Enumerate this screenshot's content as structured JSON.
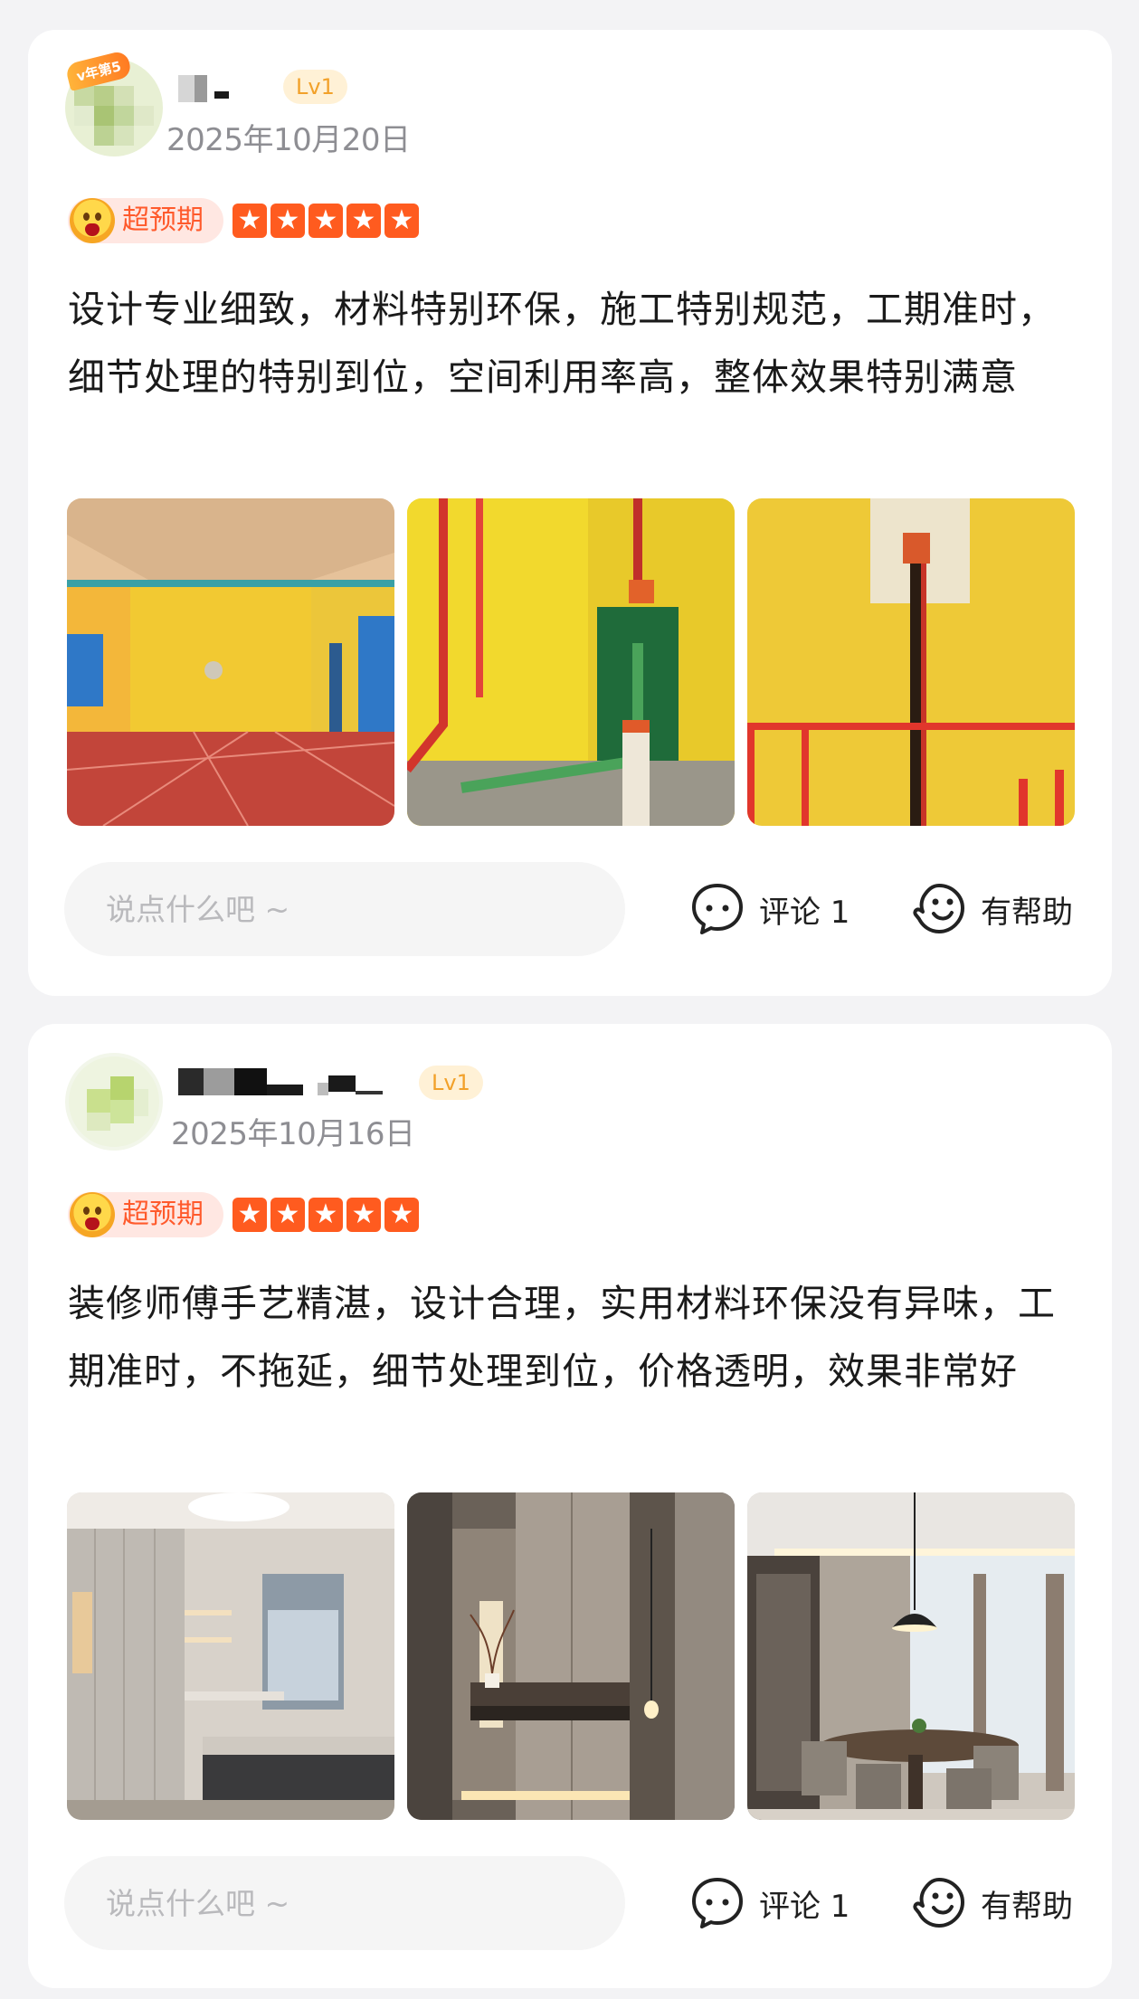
{
  "reviews": [
    {
      "avatar_badge": "v年第5",
      "level": "Lv1",
      "date": "2025年10月20日",
      "tag": "超预期",
      "rating": 5,
      "text": "设计专业细致，材料特别环保，施工特别规范，工期准时，细节处理的特别到位，空间利用率高，整体效果特别满意",
      "comment_placeholder": "说点什么吧 ~",
      "comment_label": "评论 1",
      "helpful_label": "有帮助"
    },
    {
      "level": "Lv1",
      "date": "2025年10月16日",
      "tag": "超预期",
      "rating": 5,
      "text": "装修师傅手艺精湛，设计合理，实用材料环保没有异味，工期准时，不拖延，细节处理到位，价格透明，效果非常好",
      "comment_placeholder": "说点什么吧 ~",
      "comment_label": "评论 1",
      "helpful_label": "有帮助"
    }
  ],
  "colors": {
    "accent_orange": "#ff5b1f",
    "level_text": "#f2a12a",
    "tag_bg": "#ffe7e2",
    "page_bg": "#f3f3f5"
  },
  "icons": {
    "comment": "chat-bubble-icon",
    "helpful": "thumb-smile-icon",
    "star": "star-icon"
  }
}
